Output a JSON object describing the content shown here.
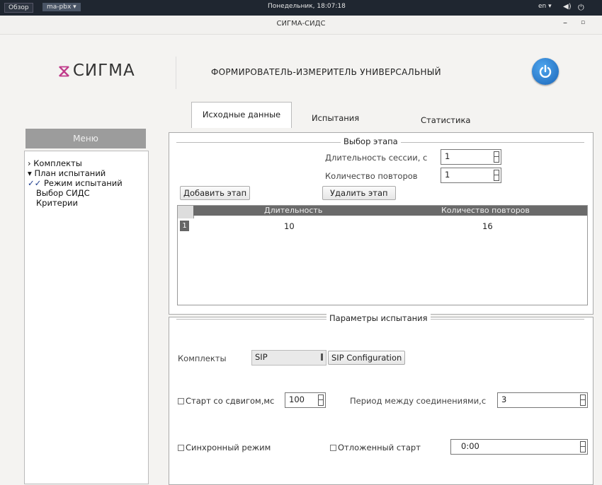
{
  "system_bar": {
    "overview": "Обзор",
    "app_menu": "ma-pbx ▾",
    "clock": "Понедельник, 18:07:18",
    "lang": "en ▾",
    "volume_icon": "volume-icon",
    "power_icon": "power-icon"
  },
  "window": {
    "title": "СИГМА-СИДС",
    "min": "–",
    "max": "▫"
  },
  "header": {
    "logo_text": "СИГМА",
    "title": "ФОРМИРОВАТЕЛЬ-ИЗМЕРИТЕЛЬ УНИВЕРСАЛЬНЫЙ",
    "power_color": "#1e6fc2"
  },
  "menu": {
    "header": "Меню",
    "items": [
      {
        "prefix": "›",
        "label": "Комплекты"
      },
      {
        "prefix": "▾",
        "label": "План испытаний"
      },
      {
        "prefix": "✓✓",
        "label": "Режим испытаний"
      },
      {
        "prefix": "",
        "label": "Выбор СИДС"
      },
      {
        "prefix": "",
        "label": "Критерии"
      }
    ]
  },
  "tabs": {
    "source": "Исходные данные",
    "tests": "Испытания",
    "stats": "Статистика"
  },
  "stage": {
    "legend": "Выбор этапа",
    "duration_label": "Длительность сессии, с",
    "duration_value": "1",
    "repeats_label": "Количество повторов",
    "repeats_value": "1",
    "add_button": "Добавить этап",
    "delete_button": "Удалить этап",
    "table": {
      "columns": [
        "Длительность",
        "Количество повторов"
      ],
      "rows": [
        {
          "num": "1",
          "duration": "10",
          "repeats": "16"
        }
      ]
    }
  },
  "params": {
    "legend": "Параметры испытания",
    "kits_label": "Комплекты",
    "kits_value": "SIP",
    "sip_config_button": "SIP Configuration",
    "start_offset_label": "Старт со сдвигом,мс",
    "start_offset_value": "100",
    "period_label": "Период между соединениями,с",
    "period_value": "3",
    "sync_label": "Синхронный режим",
    "delayed_label": "Отложенный старт",
    "delayed_value": "0:00"
  }
}
